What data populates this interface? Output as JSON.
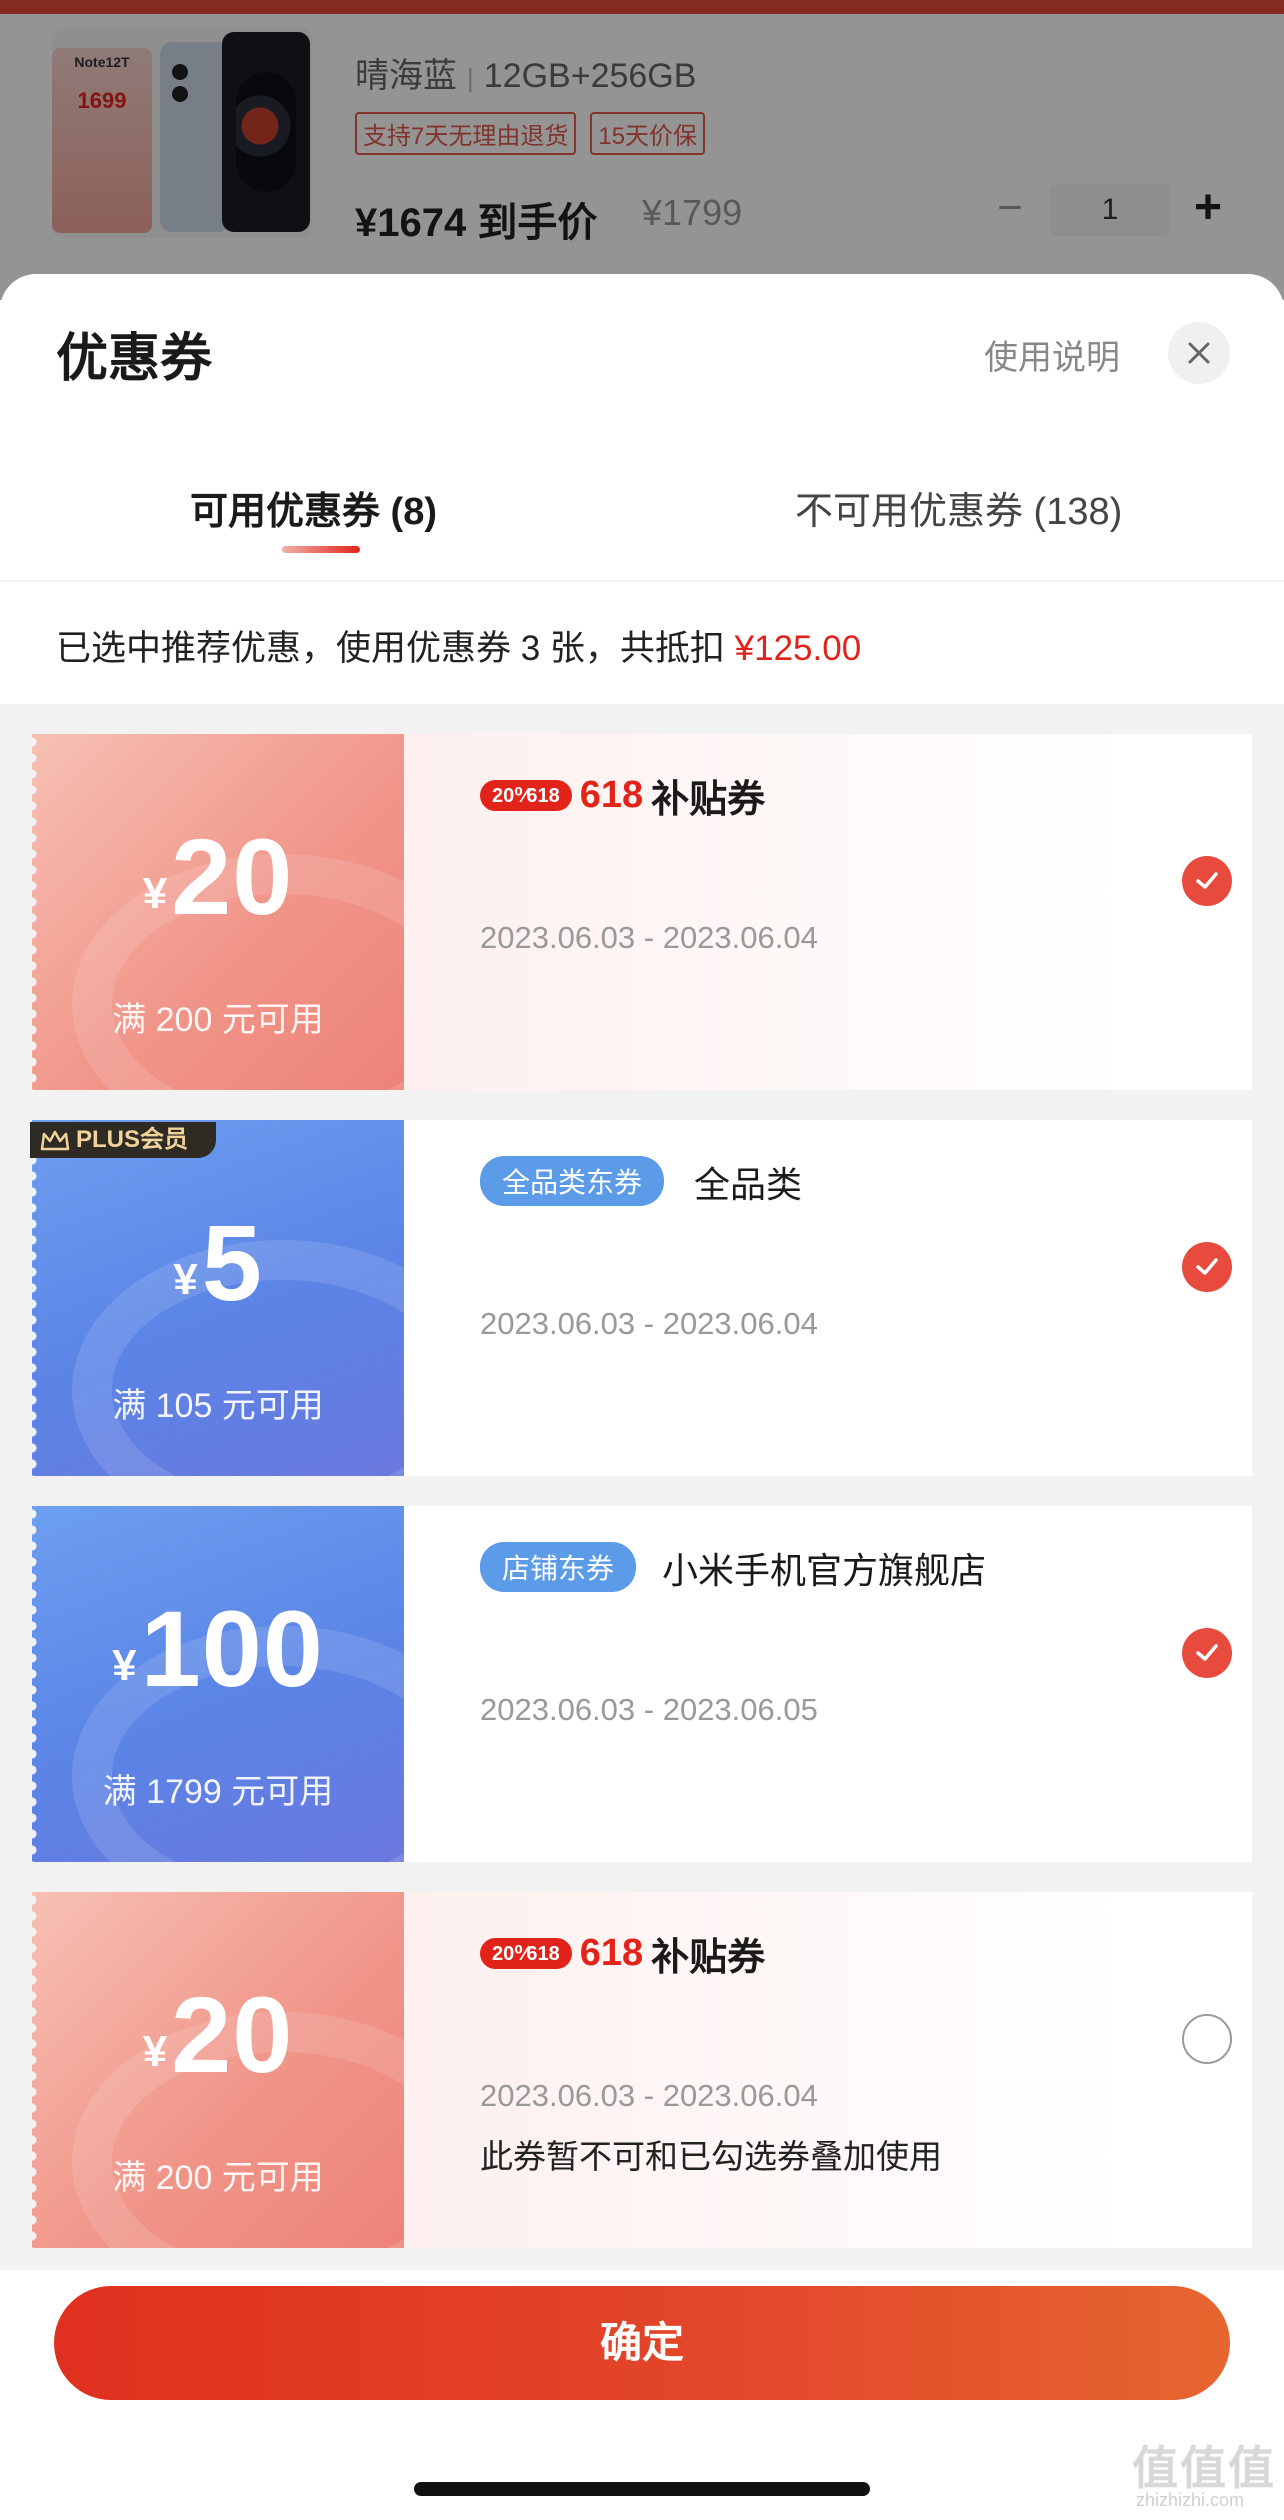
{
  "product": {
    "promo_model": "Note12T",
    "promo_price": "1699",
    "color": "晴海蓝",
    "storage": "12GB+256GB",
    "tags": [
      "支持7天无理由退货",
      "15天价保"
    ],
    "final_price": "¥1674 到手价",
    "original_price": "¥1799",
    "qty_minus": "−",
    "quantity": "1",
    "qty_plus": "+"
  },
  "sheet": {
    "title": "优惠券",
    "help": "使用说明",
    "close_icon": "close-icon"
  },
  "tabs": {
    "available": "可用优惠券 (8)",
    "unavailable": "不可用优惠券 (138)"
  },
  "summary": {
    "text": "已选中推荐优惠，使用优惠券 3 张，共抵扣 ",
    "amount": "¥125.00"
  },
  "coupons": [
    {
      "yen": "¥",
      "amount": "20",
      "condition": "满 200 元可用",
      "pill": "20⁰⁄618",
      "badge_618": "618",
      "badge_text": "补贴券",
      "dates": "2023.06.03 - 2023.06.04",
      "selected": true
    },
    {
      "plus_label": "PLUS会员",
      "yen": "¥",
      "amount": "5",
      "condition": "满 105 元可用",
      "pill": "全品类东券",
      "category": "全品类",
      "dates": "2023.06.03 - 2023.06.04",
      "selected": true
    },
    {
      "yen": "¥",
      "amount": "100",
      "condition": "满 1799 元可用",
      "pill": "店铺东券",
      "category": "小米手机官方旗舰店",
      "dates": "2023.06.03 - 2023.06.05",
      "selected": true
    },
    {
      "yen": "¥",
      "amount": "20",
      "condition": "满 200 元可用",
      "pill": "20⁰⁄618",
      "badge_618": "618",
      "badge_text": "补贴券",
      "dates": "2023.06.03 - 2023.06.04",
      "note": "此券暂不可和已勾选券叠加使用",
      "selected": false
    }
  ],
  "confirm": "确定",
  "watermark": "值值值",
  "watermark_url": "zhizhizhi.com",
  "colors": {
    "accent": "#e2231a",
    "blue": "#5b9be8"
  }
}
